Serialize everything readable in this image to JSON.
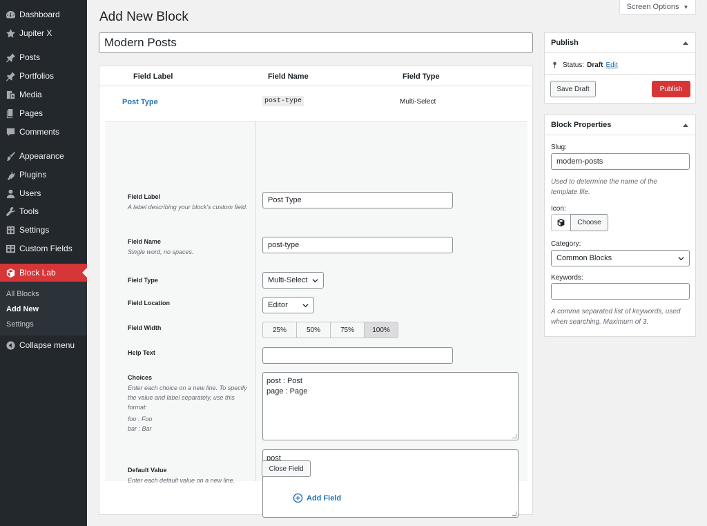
{
  "sidebar": {
    "items": [
      {
        "label": "Dashboard",
        "icon": "dashboard-icon"
      },
      {
        "label": "Jupiter X",
        "icon": "star-icon"
      },
      {
        "label": "Posts",
        "icon": "pin-icon"
      },
      {
        "label": "Portfolios",
        "icon": "pin-icon"
      },
      {
        "label": "Media",
        "icon": "media-icon"
      },
      {
        "label": "Pages",
        "icon": "pages-icon"
      },
      {
        "label": "Comments",
        "icon": "comment-icon"
      },
      {
        "label": "Appearance",
        "icon": "brush-icon"
      },
      {
        "label": "Plugins",
        "icon": "plug-icon"
      },
      {
        "label": "Users",
        "icon": "user-icon"
      },
      {
        "label": "Tools",
        "icon": "wrench-icon"
      },
      {
        "label": "Settings",
        "icon": "settings-icon"
      },
      {
        "label": "Custom Fields",
        "icon": "grid-icon"
      },
      {
        "label": "Block Lab",
        "icon": "block-lab-icon"
      }
    ],
    "submenu": [
      {
        "label": "All Blocks"
      },
      {
        "label": "Add New"
      },
      {
        "label": "Settings"
      }
    ],
    "collapse_label": "Collapse menu",
    "active_color": "#d63638"
  },
  "header": {
    "title": "Add New Block",
    "screen_options": "Screen Options"
  },
  "block_title": "Modern Posts",
  "fields_table": {
    "headers": [
      "Field Label",
      "Field Name",
      "Field Type"
    ],
    "row": {
      "label": "Post Type",
      "name": "post-type",
      "type": "Multi-Select"
    }
  },
  "field_settings": {
    "field_label": {
      "label": "Field Label",
      "desc": "A label describing your block's custom field.",
      "value": "Post Type"
    },
    "field_name": {
      "label": "Field Name",
      "desc": "Single word, no spaces.",
      "value": "post-type"
    },
    "field_type": {
      "label": "Field Type",
      "value": "Multi-Select"
    },
    "field_location": {
      "label": "Field Location",
      "value": "Editor"
    },
    "field_width": {
      "label": "Field Width",
      "options": [
        "25%",
        "50%",
        "75%",
        "100%"
      ],
      "selected": "100%"
    },
    "help_text": {
      "label": "Help Text",
      "value": ""
    },
    "choices": {
      "label": "Choices",
      "desc": "Enter each choice on a new line. To specify the value and label separately, use this format:",
      "example_1": "foo : Foo",
      "example_2": "bar : Bar",
      "line_1": "post : Post",
      "line_2": "page : Page"
    },
    "default_value": {
      "label": "Default Value",
      "desc": "Enter each default value on a new line.",
      "value": "post"
    },
    "close_button": "Close Field"
  },
  "add_field_label": "Add Field",
  "publish_box": {
    "title": "Publish",
    "status_label": "Status:",
    "status_value": "Draft",
    "edit_link": "Edit",
    "save_draft": "Save Draft",
    "publish": "Publish",
    "publish_color": "#d63638"
  },
  "properties_box": {
    "title": "Block Properties",
    "slug_label": "Slug:",
    "slug_value": "modern-posts",
    "slug_desc": "Used to determine the name of the template file.",
    "icon_label": "Icon:",
    "choose_label": "Choose",
    "category_label": "Category:",
    "category_value": "Common Blocks",
    "keywords_label": "Keywords:",
    "keywords_value": "",
    "keywords_desc": "A comma separated list of keywords, used when searching. Maximum of 3."
  }
}
